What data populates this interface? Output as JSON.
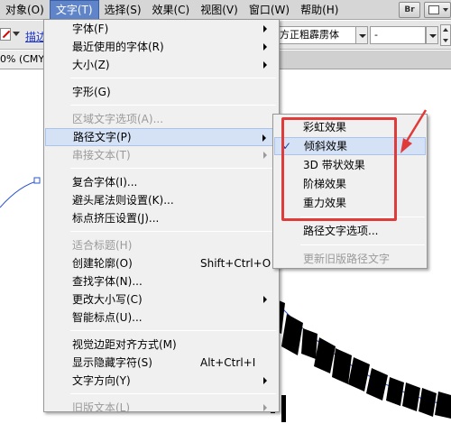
{
  "menubar": {
    "items": [
      "对象(O)",
      "文字(T)",
      "选择(S)",
      "效果(C)",
      "视图(V)",
      "窗口(W)",
      "帮助(H)"
    ],
    "active_index": 1,
    "right_icons": [
      {
        "name": "bridge-icon",
        "label": "Br"
      },
      {
        "name": "arrange-documents-icon",
        "label": ""
      }
    ]
  },
  "controlbar": {
    "stroke_link": "描边",
    "font_name": "方正粗霹雳体",
    "font_style": "-"
  },
  "doc_tab": {
    "label": "0% (CMYK"
  },
  "text_menu": {
    "items": [
      {
        "label": "字体(F)",
        "shortcut": "",
        "submenu": true,
        "disabled": false
      },
      {
        "label": "最近使用的字体(R)",
        "shortcut": "",
        "submenu": true,
        "disabled": false
      },
      {
        "label": "大小(Z)",
        "shortcut": "",
        "submenu": true,
        "disabled": false
      },
      {
        "sep": true
      },
      {
        "label": "字形(G)",
        "shortcut": "",
        "submenu": false,
        "disabled": false
      },
      {
        "sep": true
      },
      {
        "label": "区域文字选项(A)...",
        "shortcut": "",
        "submenu": false,
        "disabled": true
      },
      {
        "label": "路径文字(P)",
        "shortcut": "",
        "submenu": true,
        "disabled": false,
        "highlight": true
      },
      {
        "label": "串接文本(T)",
        "shortcut": "",
        "submenu": true,
        "disabled": true
      },
      {
        "sep": true
      },
      {
        "label": "复合字体(I)...",
        "shortcut": "",
        "submenu": false,
        "disabled": false
      },
      {
        "label": "避头尾法则设置(K)...",
        "shortcut": "",
        "submenu": false,
        "disabled": false
      },
      {
        "label": "标点挤压设置(J)...",
        "shortcut": "",
        "submenu": false,
        "disabled": false
      },
      {
        "sep": true
      },
      {
        "label": "适合标题(H)",
        "shortcut": "",
        "submenu": false,
        "disabled": true
      },
      {
        "label": "创建轮廓(O)",
        "shortcut": "Shift+Ctrl+O",
        "submenu": false,
        "disabled": false
      },
      {
        "label": "查找字体(N)...",
        "shortcut": "",
        "submenu": false,
        "disabled": false
      },
      {
        "label": "更改大小写(C)",
        "shortcut": "",
        "submenu": true,
        "disabled": false
      },
      {
        "label": "智能标点(U)...",
        "shortcut": "",
        "submenu": false,
        "disabled": false
      },
      {
        "sep": true
      },
      {
        "label": "视觉边距对齐方式(M)",
        "shortcut": "",
        "submenu": false,
        "disabled": false
      },
      {
        "label": "显示隐藏字符(S)",
        "shortcut": "Alt+Ctrl+I",
        "submenu": false,
        "disabled": false
      },
      {
        "label": "文字方向(Y)",
        "shortcut": "",
        "submenu": true,
        "disabled": false
      },
      {
        "sep": true
      },
      {
        "label": "旧版文本(L)",
        "shortcut": "",
        "submenu": true,
        "disabled": true
      }
    ]
  },
  "path_text_submenu": {
    "items": [
      {
        "label": "彩虹效果",
        "checked": false,
        "disabled": false
      },
      {
        "label": "倾斜效果",
        "checked": true,
        "disabled": false
      },
      {
        "label": "3D 带状效果",
        "checked": false,
        "disabled": false
      },
      {
        "label": "阶梯效果",
        "checked": false,
        "disabled": false
      },
      {
        "label": "重力效果",
        "checked": false,
        "disabled": false
      },
      {
        "sep": true
      },
      {
        "label": "路径文字选项...",
        "checked": false,
        "disabled": false
      },
      {
        "sep": true
      },
      {
        "label": "更新旧版路径文字",
        "checked": false,
        "disabled": true
      }
    ]
  },
  "colors": {
    "menu_highlight": "#d5e2f6",
    "annotation_red": "#e03b3b",
    "path_blue": "#2b55d0"
  }
}
